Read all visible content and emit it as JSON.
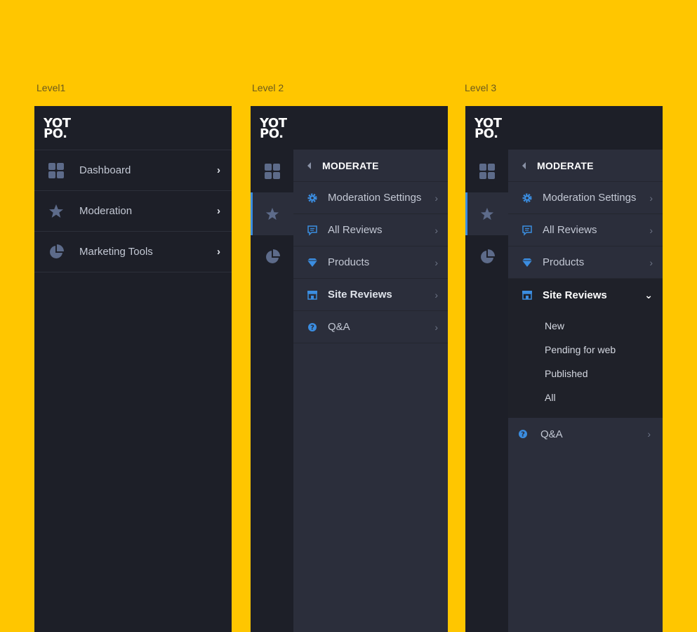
{
  "captions": {
    "level1": "Level1",
    "level2": "Level 2",
    "level3": "Level 3"
  },
  "logo": {
    "line1": "YOT",
    "line2": "PO."
  },
  "main_menu": [
    {
      "label": "Dashboard",
      "icon": "dashboard-grid-icon"
    },
    {
      "label": "Moderation",
      "icon": "star-icon"
    },
    {
      "label": "Marketing Tools",
      "icon": "pie-chart-icon"
    }
  ],
  "submenu": {
    "title": "MODERATE",
    "items": [
      {
        "label": "Moderation Settings",
        "icon": "gear-icon"
      },
      {
        "label": "All Reviews",
        "icon": "chat-icon"
      },
      {
        "label": "Products",
        "icon": "diamond-icon"
      },
      {
        "label": "Site Reviews",
        "icon": "store-icon"
      },
      {
        "label": "Q&A",
        "icon": "question-icon"
      }
    ],
    "site_reviews_children": [
      "New",
      "Pending for web",
      "Published",
      "All"
    ]
  },
  "colors": {
    "background": "#ffc600",
    "panel": "#1d1f28",
    "submenu": "#2b2e3b",
    "accent": "#3b8de0",
    "icon_muted": "#5d6b8a"
  }
}
